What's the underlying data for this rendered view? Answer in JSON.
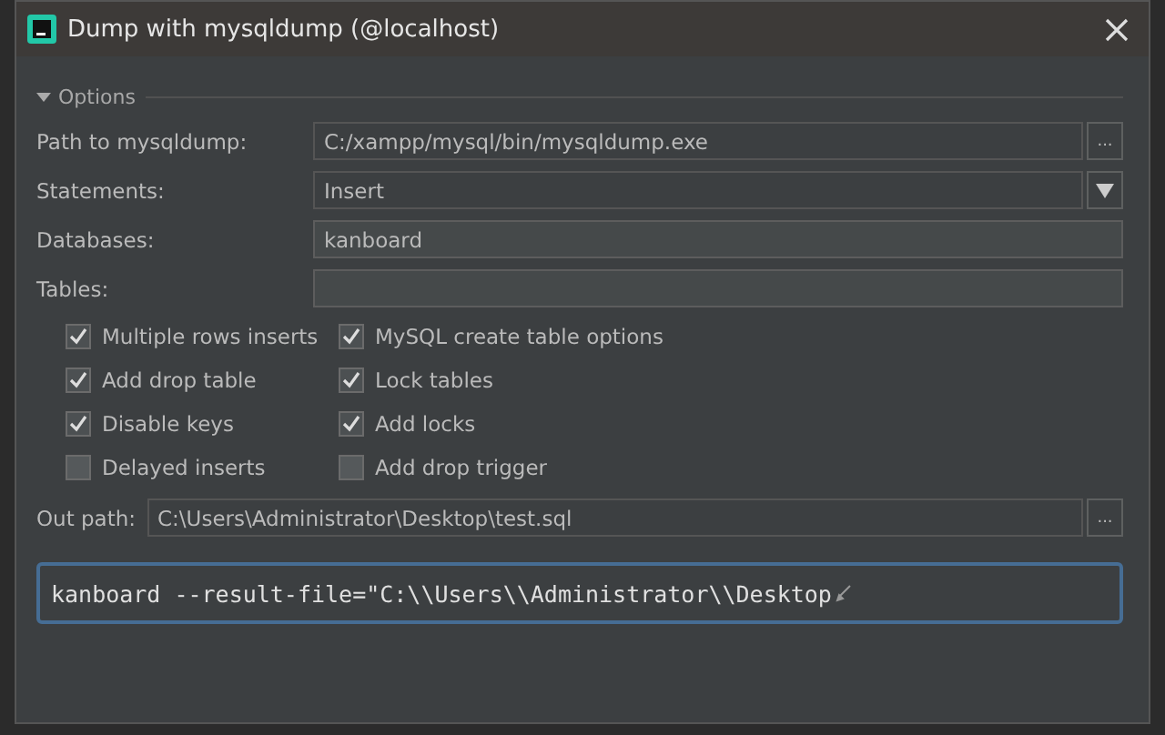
{
  "window": {
    "title": "Dump with mysqldump (@localhost)"
  },
  "options": {
    "title": "Options",
    "expanded": true
  },
  "fields": [
    {
      "kind": "browse",
      "label": "Path to mysqldump:",
      "value": "C:/xampp/mysql/bin/mysqldump.exe",
      "button": "..."
    },
    {
      "kind": "dropdown",
      "label": "Statements:",
      "value": "Insert"
    },
    {
      "kind": "text",
      "label": "Databases:",
      "value": "kanboard"
    },
    {
      "kind": "text",
      "label": "Tables:"
    }
  ],
  "checkboxes": [
    {
      "label": "Multiple rows inserts",
      "checked": true
    },
    {
      "label": "MySQL create table options",
      "checked": true
    },
    {
      "label": "Add drop table",
      "checked": true
    },
    {
      "label": "Lock tables",
      "checked": true
    },
    {
      "label": "Disable keys",
      "checked": true
    },
    {
      "label": "Add locks",
      "checked": true
    },
    {
      "label": "Delayed inserts",
      "checked": false
    },
    {
      "label": "Add drop trigger",
      "checked": false
    }
  ],
  "out_path": {
    "label": "Out path:",
    "value": "C:\\Users\\Administrator\\Desktop\\test.sql",
    "button": "..."
  },
  "command": {
    "value": "kanboard --result-file=\"C:\\\\Users\\\\Administrator\\\\Desktop"
  }
}
